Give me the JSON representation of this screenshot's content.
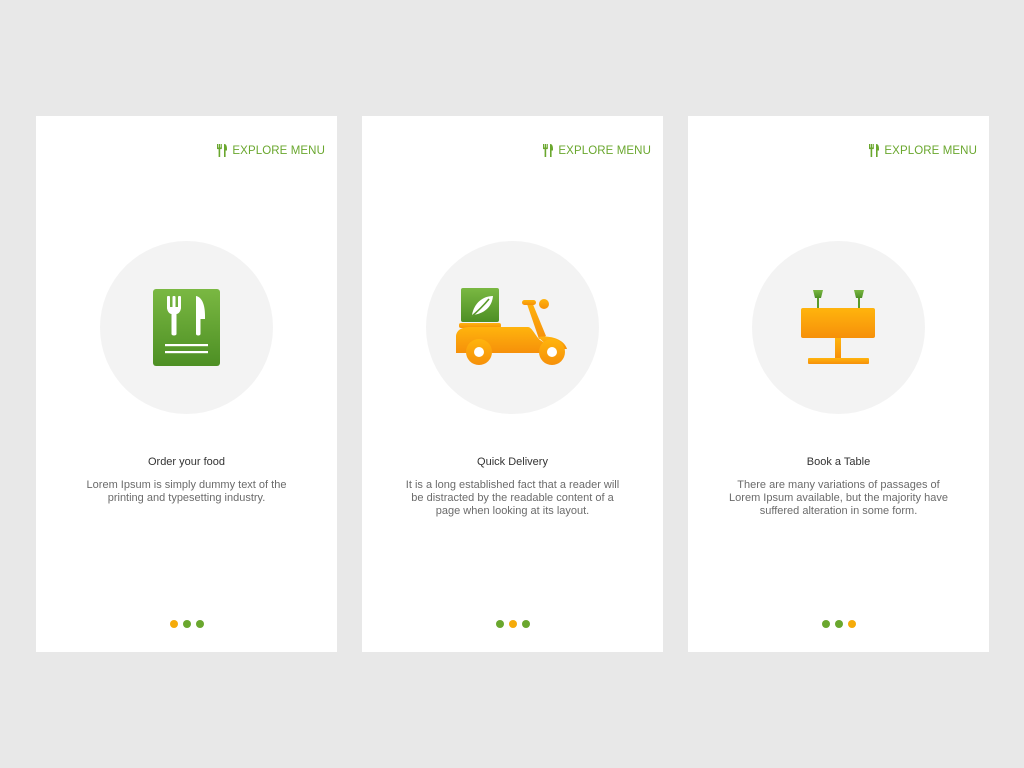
{
  "colors": {
    "background": "#e8e8e8",
    "card": "#ffffff",
    "accent_green": "#6aa72e",
    "accent_orange": "#f5ab0a",
    "circle_bg": "#f3f3f3"
  },
  "screens": [
    {
      "explore_label": "EXPLORE MENU",
      "icon": "fork-knife-menu-icon",
      "title": "Order your food",
      "description": "Lorem Ipsum is simply dummy text of the printing and typesetting industry.",
      "active_dot": 0
    },
    {
      "explore_label": "EXPLORE MENU",
      "icon": "delivery-scooter-icon",
      "title": "Quick Delivery",
      "description": "It is a long established fact that a reader will be distracted by the readable content of a page when looking at its layout.",
      "active_dot": 1
    },
    {
      "explore_label": "EXPLORE MENU",
      "icon": "table-with-glasses-icon",
      "title": "Book a Table",
      "description": "There are many variations of passages of Lorem Ipsum available, but the majority have suffered alteration in some form.",
      "active_dot": 2
    }
  ]
}
